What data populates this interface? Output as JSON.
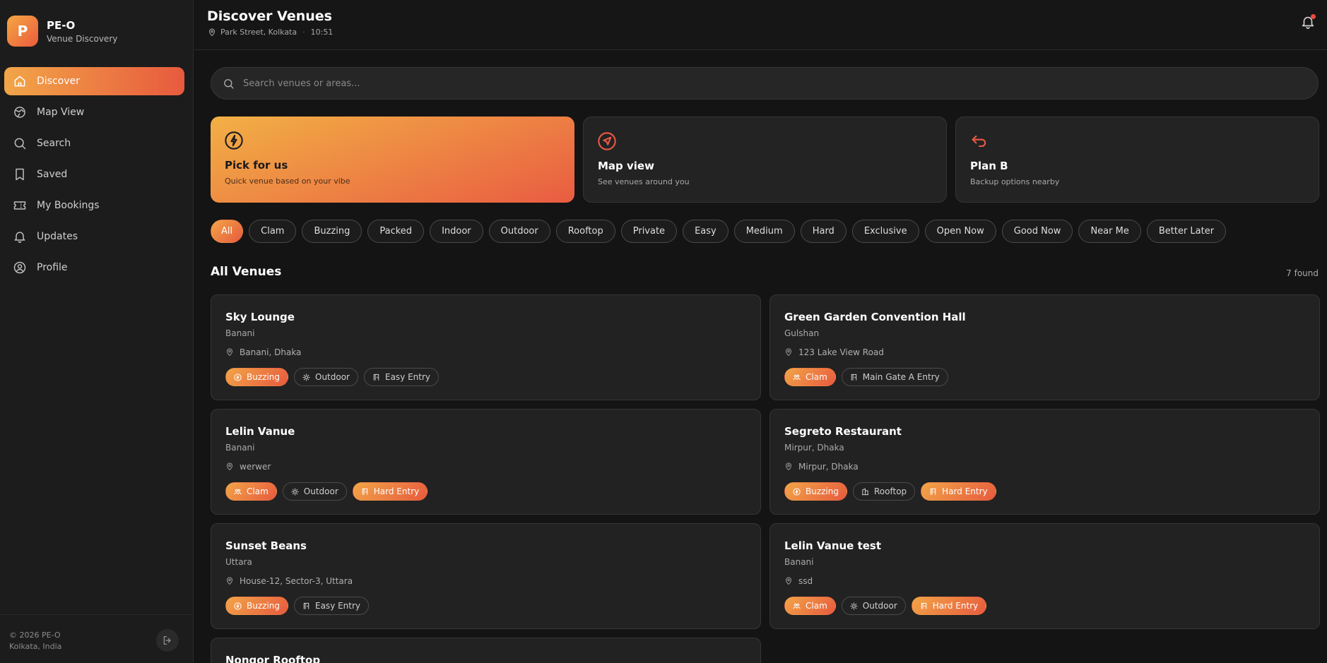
{
  "brand": {
    "logo_letter": "P",
    "name": "PE-O",
    "subtitle": "Venue Discovery"
  },
  "sidebar": {
    "items": [
      {
        "label": "Discover",
        "icon": "home-icon",
        "active": true
      },
      {
        "label": "Map View",
        "icon": "map-icon"
      },
      {
        "label": "Search",
        "icon": "search-icon"
      },
      {
        "label": "Saved",
        "icon": "bookmark-icon"
      },
      {
        "label": "My Bookings",
        "icon": "ticket-icon"
      },
      {
        "label": "Updates",
        "icon": "bell-icon"
      },
      {
        "label": "Profile",
        "icon": "user-circle-icon"
      }
    ],
    "footer": {
      "copyright": "© 2026 PE-O",
      "location": "Kolkata, India",
      "logout_icon": "logout-icon"
    }
  },
  "header": {
    "title": "Discover Venues",
    "location": "Park Street, Kolkata",
    "time": "10:51",
    "separator": "·",
    "notification_icon": "bell-icon"
  },
  "search": {
    "placeholder": "Search venues or areas..."
  },
  "quick_actions": [
    {
      "title": "Pick for us",
      "subtitle": "Quick venue based on your vibe",
      "icon": "lightning-icon"
    },
    {
      "title": "Map view",
      "subtitle": "See venues around you",
      "icon": "navigation-icon"
    },
    {
      "title": "Plan B",
      "subtitle": "Backup options nearby",
      "icon": "return-arrow-icon"
    }
  ],
  "filters": [
    "All",
    "Clam",
    "Buzzing",
    "Packed",
    "Indoor",
    "Outdoor",
    "Rooftop",
    "Private",
    "Easy",
    "Medium",
    "Hard",
    "Exclusive",
    "Open Now",
    "Good Now",
    "Near Me",
    "Better Later"
  ],
  "active_filter": "All",
  "section": {
    "title": "All Venues",
    "count": "7 found"
  },
  "colors": {
    "accent_start": "#f2a548",
    "accent_end": "#e75a3e",
    "background": "#141414",
    "card": "#222222"
  },
  "venues": [
    {
      "name": "Sky Lounge",
      "area": "Banani",
      "address": "Banani, Dhaka",
      "tags": [
        {
          "label": "Buzzing",
          "icon": "lightning-icon",
          "highlight": true
        },
        {
          "label": "Outdoor",
          "icon": "sun-icon"
        },
        {
          "label": "Easy Entry",
          "icon": "door-icon"
        }
      ]
    },
    {
      "name": "Green Garden Convention Hall",
      "area": "Gulshan",
      "address": "123 Lake View Road",
      "tags": [
        {
          "label": "Clam",
          "icon": "people-icon",
          "highlight": true
        },
        {
          "label": "Main Gate A Entry",
          "icon": "door-icon"
        }
      ]
    },
    {
      "name": "Lelin Vanue",
      "area": "Banani",
      "address": "werwer",
      "tags": [
        {
          "label": "Clam",
          "icon": "people-icon",
          "highlight": true
        },
        {
          "label": "Outdoor",
          "icon": "sun-icon"
        },
        {
          "label": "Hard Entry",
          "icon": "door-icon",
          "highlight": true
        }
      ]
    },
    {
      "name": "Segreto Restaurant",
      "area": "Mirpur, Dhaka",
      "address": "Mirpur, Dhaka",
      "tags": [
        {
          "label": "Buzzing",
          "icon": "lightning-icon",
          "highlight": true
        },
        {
          "label": "Rooftop",
          "icon": "building-icon"
        },
        {
          "label": "Hard Entry",
          "icon": "door-icon",
          "highlight": true
        }
      ]
    },
    {
      "name": "Sunset Beans",
      "area": "Uttara",
      "address": "House-12, Sector-3, Uttara",
      "tags": [
        {
          "label": "Buzzing",
          "icon": "lightning-icon",
          "highlight": true
        },
        {
          "label": "Easy Entry",
          "icon": "door-icon"
        }
      ]
    },
    {
      "name": "Lelin Vanue test",
      "area": "Banani",
      "address": "ssd",
      "tags": [
        {
          "label": "Clam",
          "icon": "people-icon",
          "highlight": true
        },
        {
          "label": "Outdoor",
          "icon": "sun-icon"
        },
        {
          "label": "Hard Entry",
          "icon": "door-icon",
          "highlight": true
        }
      ]
    },
    {
      "name": "Nongor Rooftop",
      "area": "",
      "address": "",
      "tags": []
    }
  ]
}
